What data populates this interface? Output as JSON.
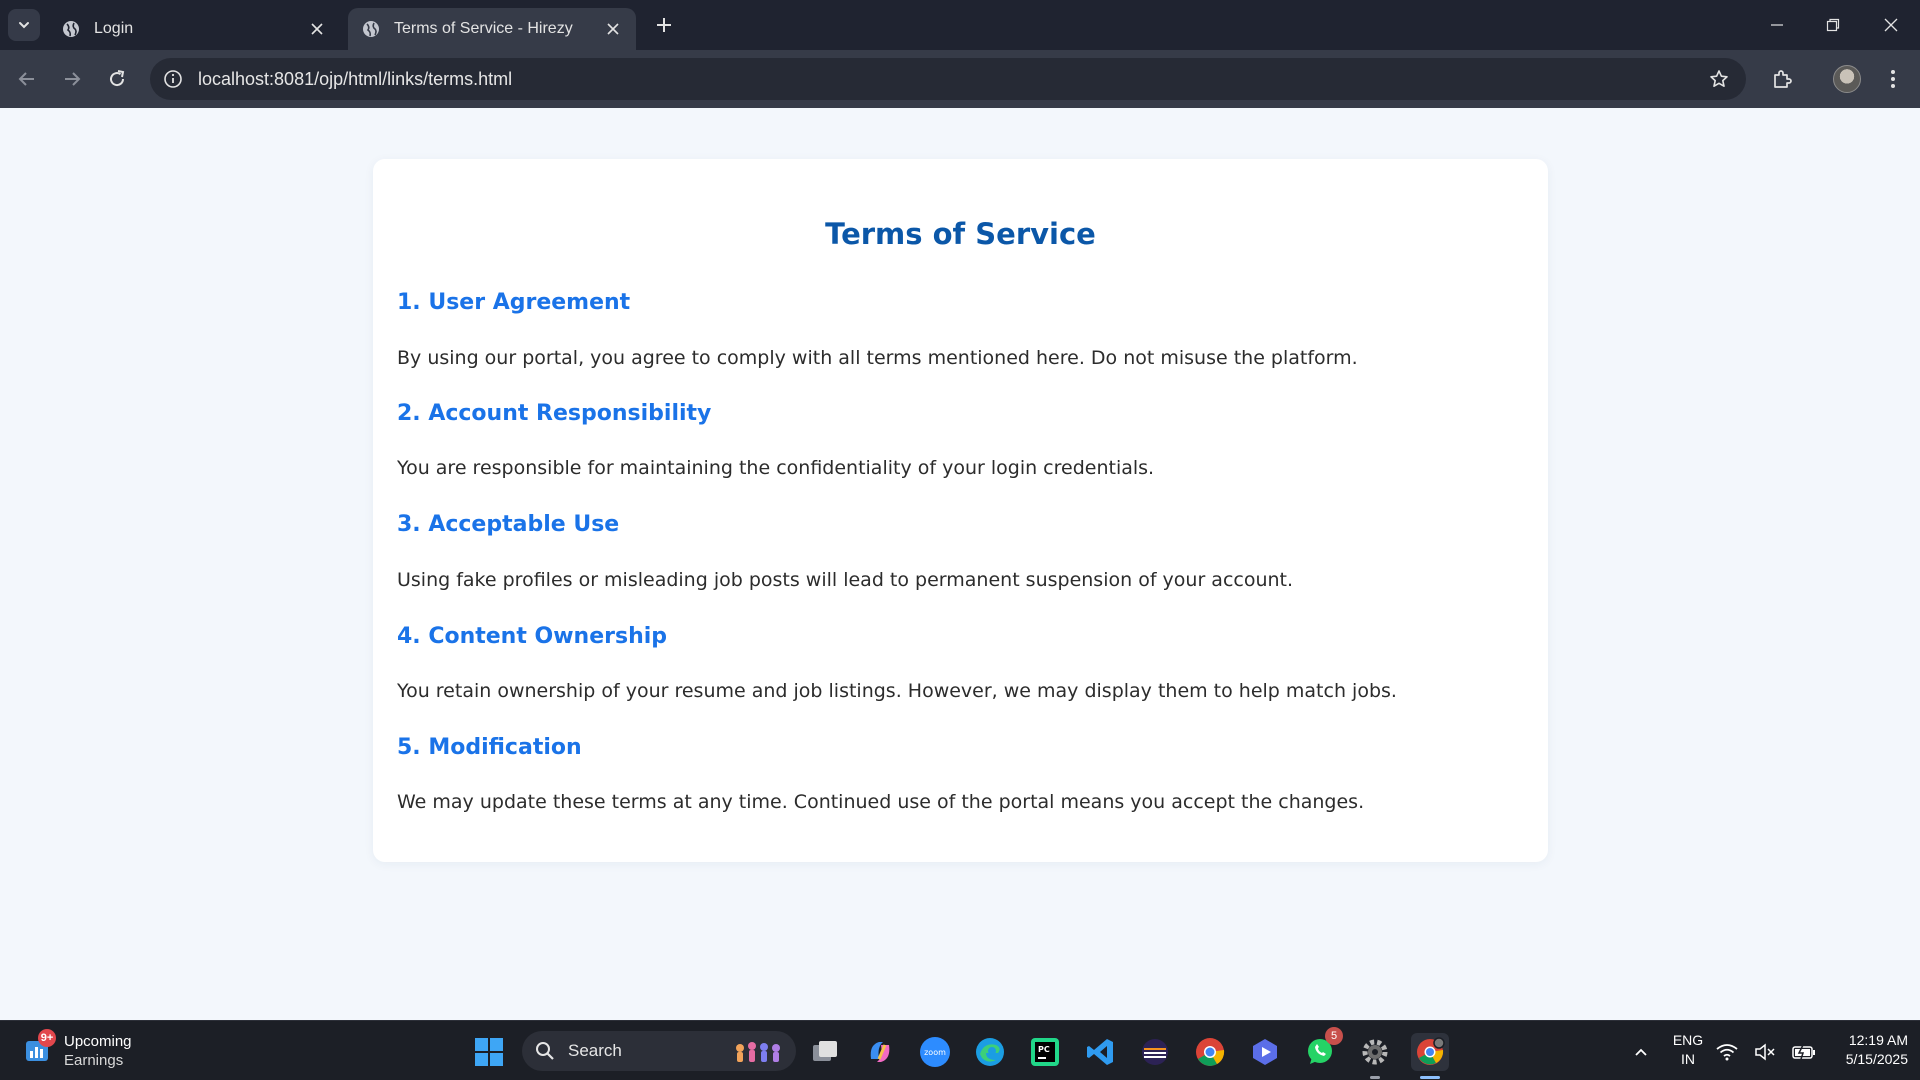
{
  "browser": {
    "tabs": [
      {
        "title": "Login",
        "active": false
      },
      {
        "title": "Terms of Service - Hirezy",
        "active": true
      }
    ],
    "url": "localhost:8081/ojp/html/links/terms.html"
  },
  "page": {
    "title": "Terms of Service",
    "sections": [
      {
        "heading": "1. User Agreement",
        "text": "By using our portal, you agree to comply with all terms mentioned here. Do not misuse the platform."
      },
      {
        "heading": "2. Account Responsibility",
        "text": "You are responsible for maintaining the confidentiality of your login credentials."
      },
      {
        "heading": "3. Acceptable Use",
        "text": "Using fake profiles or misleading job posts will lead to permanent suspension of your account."
      },
      {
        "heading": "4. Content Ownership",
        "text": "You retain ownership of your resume and job listings. However, we may display them to help match jobs."
      },
      {
        "heading": "5. Modification",
        "text": "We may update these terms at any time. Continued use of the portal means you accept the changes."
      }
    ]
  },
  "taskbar": {
    "widget": {
      "badge": "9+",
      "line1": "Upcoming",
      "line2": "Earnings"
    },
    "search_label": "Search",
    "whatsapp_badge": "5",
    "language": {
      "line1": "ENG",
      "line2": "IN"
    },
    "clock": {
      "time": "12:19 AM",
      "date": "5/15/2025"
    }
  },
  "colors": {
    "title": "#0b57a8",
    "heading": "#1a73e8",
    "page_bg": "#f3f7fc",
    "chrome_dark": "#1f2330",
    "taskbar": "#1c1f26"
  }
}
